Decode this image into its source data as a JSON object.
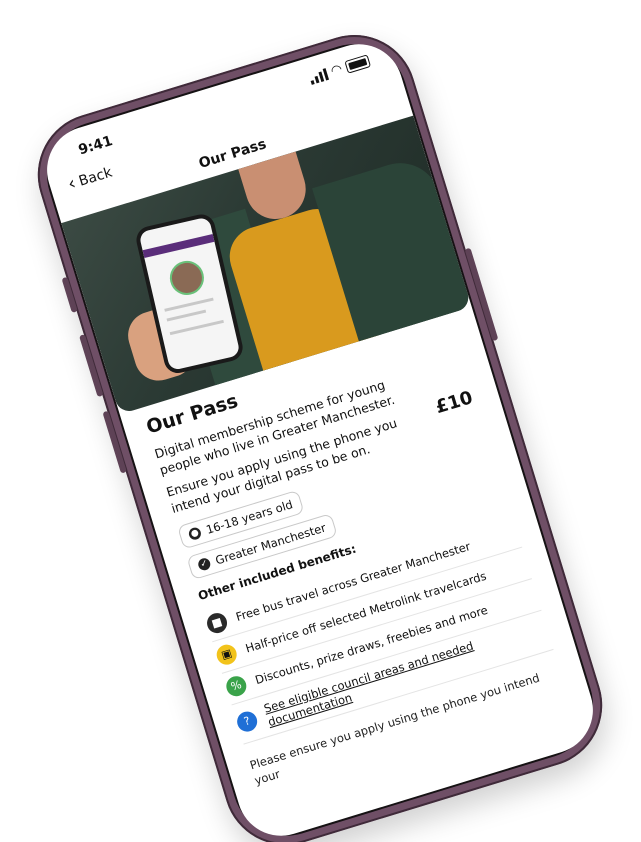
{
  "status": {
    "time": "9:41"
  },
  "nav": {
    "back_label": "Back",
    "title": "Our Pass"
  },
  "pass": {
    "title": "Our Pass",
    "price": "£10",
    "description": "Digital membership scheme for young people who live in Greater Manchester.",
    "instruction": "Ensure you apply using the phone you intend your digital pass to be on.",
    "chips": [
      {
        "label": "16-18 years old",
        "icon": "person-icon"
      },
      {
        "label": "Greater Manchester",
        "icon": "check-badge-icon"
      }
    ]
  },
  "benefits": {
    "title": "Other included benefits:",
    "items": [
      {
        "label": "Free bus travel across Greater Manchester",
        "icon": "bus-icon"
      },
      {
        "label": "Half-price off selected Metrolink travelcards",
        "icon": "tram-icon"
      },
      {
        "label": "Discounts, prize draws, freebies and more",
        "icon": "discount-icon"
      }
    ],
    "link": {
      "label": "See eligible council areas and needed documentation",
      "icon": "info-icon"
    }
  },
  "footer_note": "Please ensure you apply using the phone you intend your"
}
